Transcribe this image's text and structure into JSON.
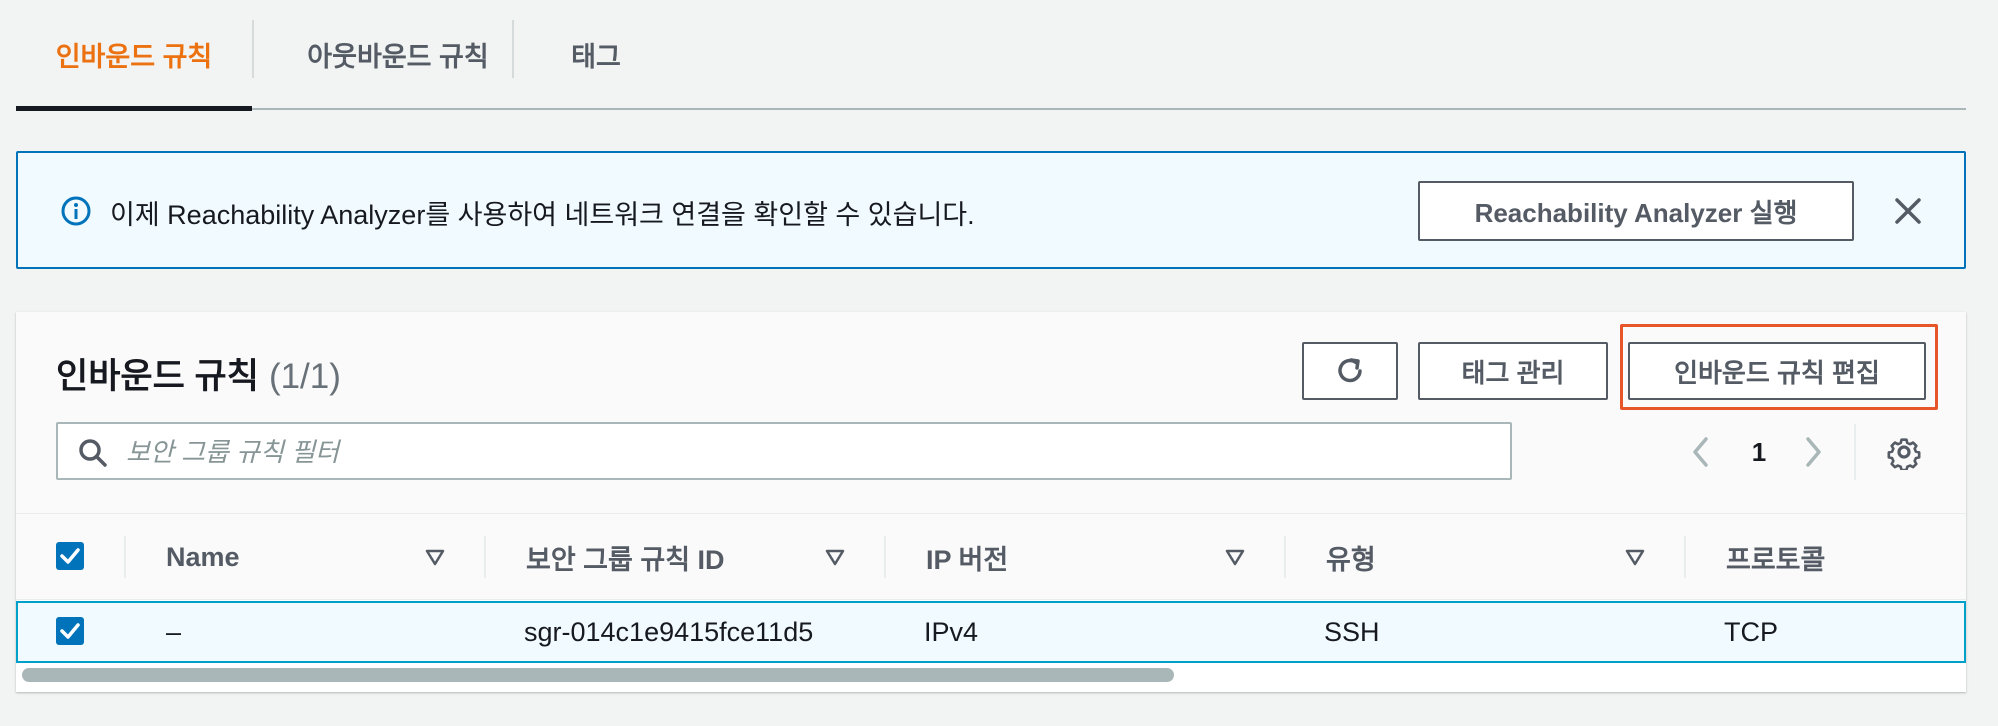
{
  "tabs": [
    {
      "label": "인바운드 규칙",
      "active": true
    },
    {
      "label": "아웃바운드 규칙",
      "active": false
    },
    {
      "label": "태그",
      "active": false
    }
  ],
  "flash": {
    "icon": "info-icon",
    "message": "이제 Reachability Analyzer를 사용하여 네트워크 연결을 확인할 수 있습니다.",
    "action_label": "Reachability Analyzer 실행",
    "close_icon": "close-icon"
  },
  "panel": {
    "title": "인바운드 규칙",
    "count": "(1/1)",
    "refresh_icon": "refresh-icon",
    "manage_tags_label": "태그 관리",
    "edit_label": "인바운드 규칙 편집",
    "search_placeholder": "보안 그룹 규칙 필터",
    "page_number": "1"
  },
  "table": {
    "columns": [
      "Name",
      "보안 그룹 규칙 ID",
      "IP 버전",
      "유형",
      "프로토콜"
    ],
    "rows": [
      {
        "selected": true,
        "name": "–",
        "rule_id": "sgr-014c1e9415fce11d5",
        "ip_version": "IPv4",
        "type": "SSH",
        "protocol": "TCP"
      }
    ]
  },
  "colors": {
    "accent": "#ec7211",
    "info": "#0073bb",
    "highlight": "#e8552a",
    "selected_row_border": "#00a1c9"
  }
}
